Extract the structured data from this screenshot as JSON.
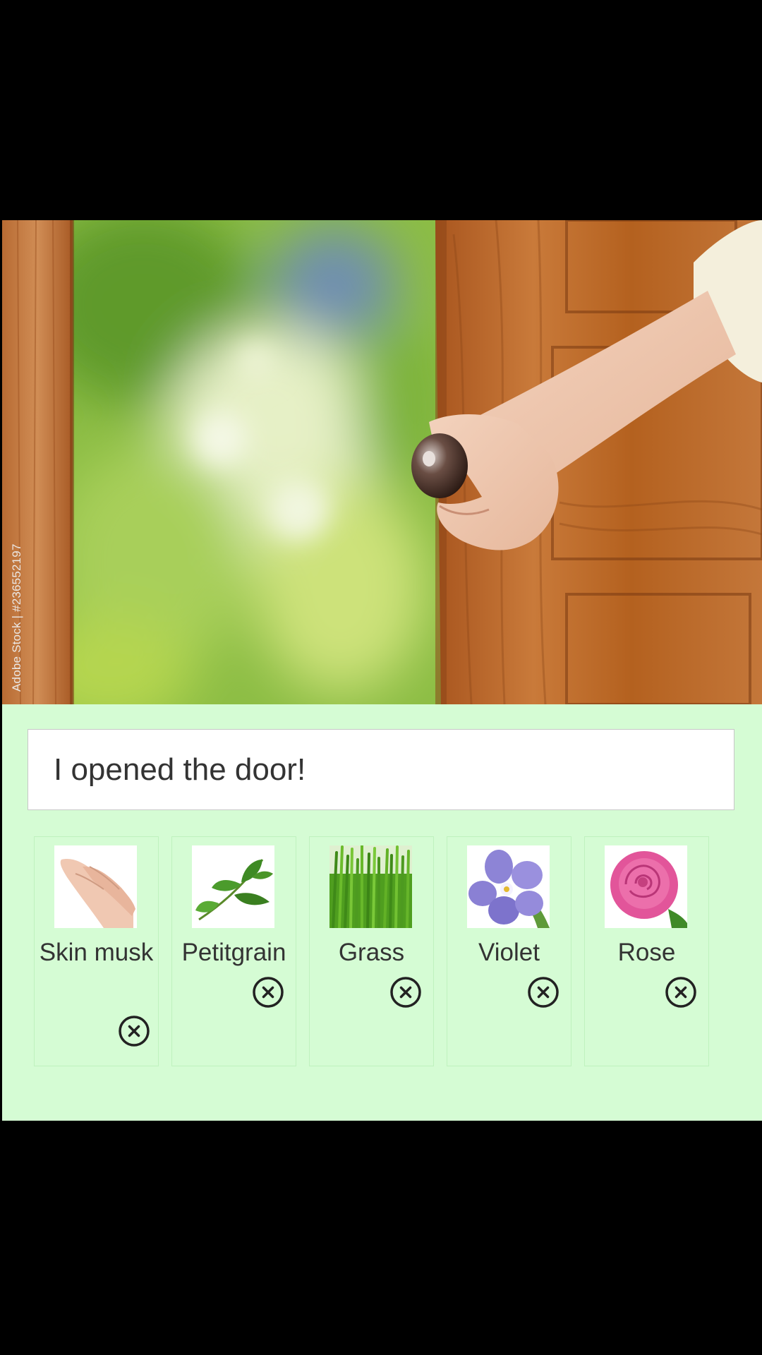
{
  "hero": {
    "image_icon": "door-opening-photo",
    "watermark": "Adobe Stock | #236552197"
  },
  "message": {
    "text": "I opened the door!"
  },
  "notes": [
    {
      "label": "Skin musk",
      "icon": "hand-photo",
      "remove_icon": "close-circle-icon"
    },
    {
      "label": "Petitgrain",
      "icon": "leaf-photo",
      "remove_icon": "close-circle-icon"
    },
    {
      "label": "Grass",
      "icon": "grass-photo",
      "remove_icon": "close-circle-icon"
    },
    {
      "label": "Violet",
      "icon": "violet-flower-photo",
      "remove_icon": "close-circle-icon"
    },
    {
      "label": "Rose",
      "icon": "rose-photo",
      "remove_icon": "close-circle-icon"
    }
  ],
  "colors": {
    "panel_bg": "#d5fcd4",
    "text": "#333333",
    "screen_bg": "#000000"
  }
}
